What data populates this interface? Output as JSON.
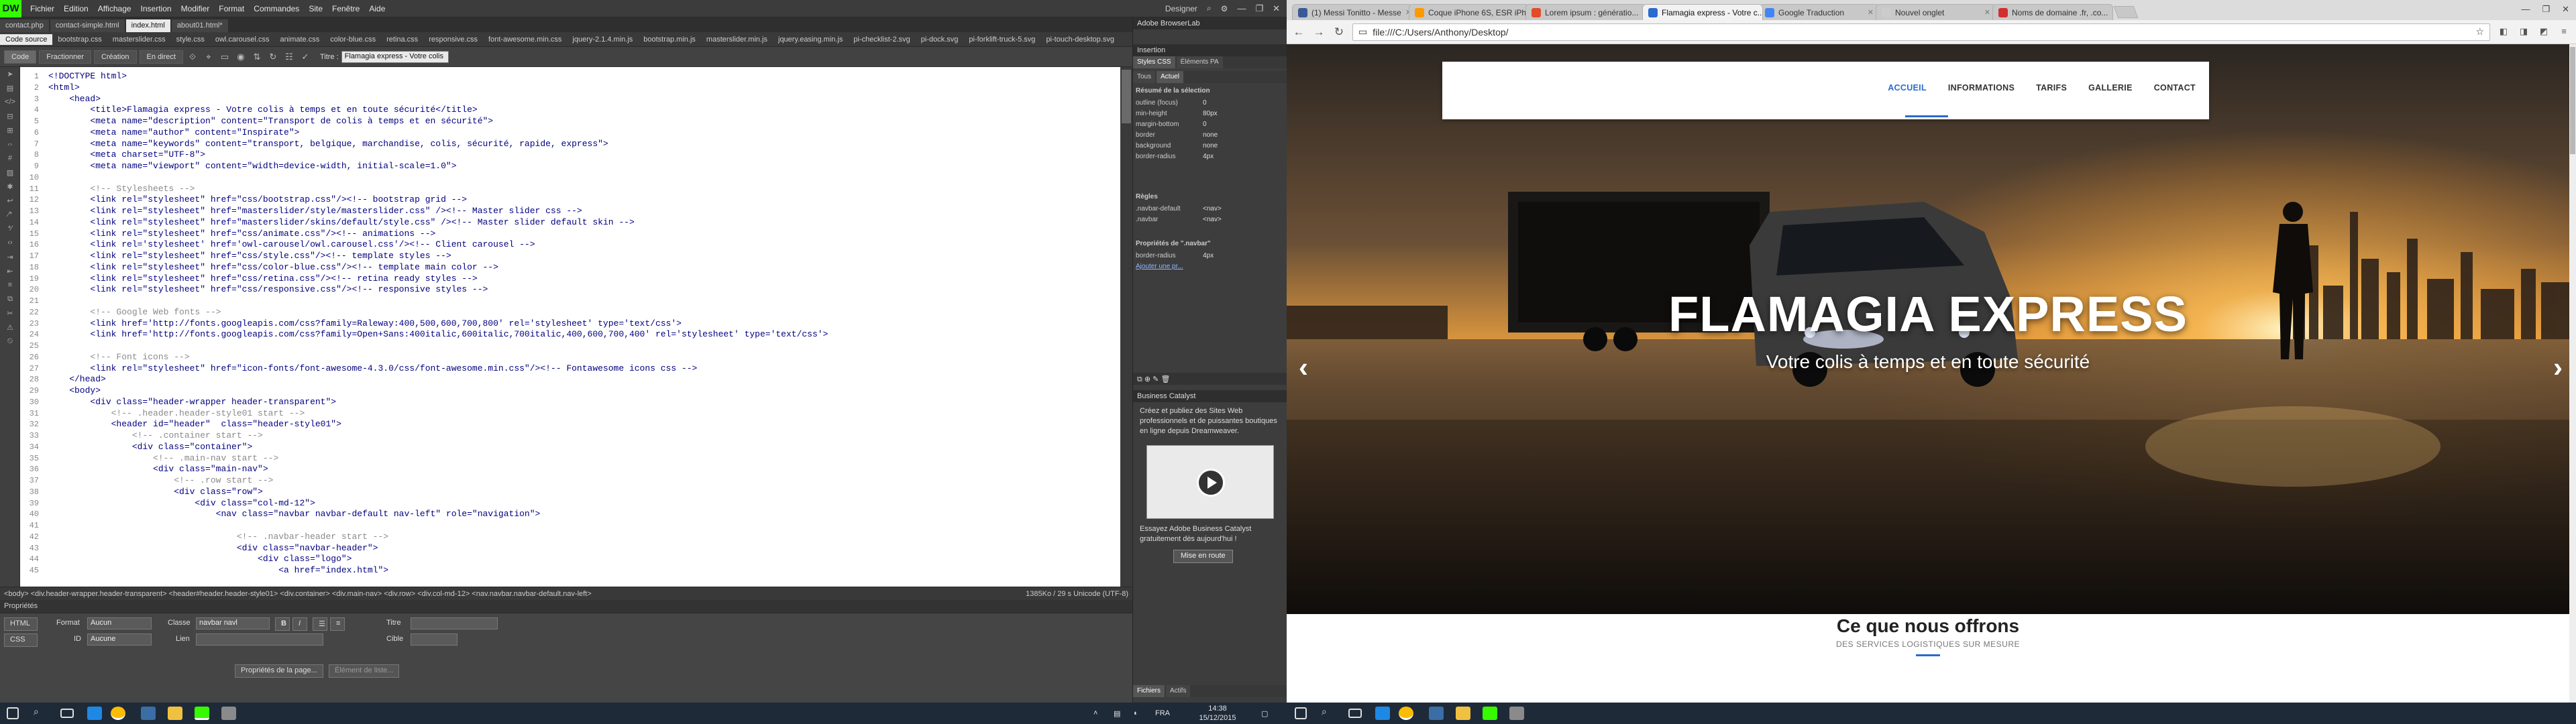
{
  "dw": {
    "logo": "DW",
    "menus": [
      "Fichier",
      "Edition",
      "Affichage",
      "Insertion",
      "Modifier",
      "Format",
      "Commandes",
      "Site",
      "Fenêtre",
      "Aide"
    ],
    "workspace": "Designer",
    "doc_tabs": [
      "contact.php",
      "contact-simple.html",
      "index.html",
      "about01.html*"
    ],
    "active_doc_tab": 2,
    "related_files": [
      "Code source",
      "bootstrap.css",
      "masterslider.css",
      "style.css",
      "owl.carousel.css",
      "animate.css",
      "color-blue.css",
      "retina.css",
      "responsive.css",
      "font-awesome.min.css",
      "jquery-2.1.4.min.js",
      "bootstrap.min.js",
      "masterslider.min.js",
      "jquery.easing.min.js",
      "pi-checklist-2.svg",
      "pi-dock.svg",
      "pi-forklift-truck-5.svg",
      "pi-touch-desktop.svg"
    ],
    "view_buttons": [
      "Code",
      "Fractionner",
      "Création",
      "En direct"
    ],
    "title_label": "Titre :",
    "title_value": "Flamagia express - Votre colis",
    "gutter_icons": [
      "pointer-icon",
      "file-icon",
      "code-icon",
      "collapse-icon",
      "expand-icon",
      "select-icon",
      "line-numbers-icon",
      "highlight-icon",
      "syntax-icon",
      "wrap-icon",
      "comment-icon",
      "uncomment-icon",
      "tag-icon",
      "indent-icon",
      "outdent-icon",
      "format-icon",
      "move-css-icon",
      "snippet-icon",
      "error-icon",
      "recent-icon"
    ],
    "code_lines": [
      {
        "t": "<!DOCTYPE html>",
        "c": false
      },
      {
        "t": "<html>",
        "c": false
      },
      {
        "t": "    <head>",
        "c": false
      },
      {
        "t": "        <title>Flamagia express - Votre colis à temps et en toute sécurité</title>",
        "c": false
      },
      {
        "t": "        <meta name=\"description\" content=\"Transport de colis à temps et en sécurité\">",
        "c": false
      },
      {
        "t": "        <meta name=\"author\" content=\"Inspirate\">",
        "c": false
      },
      {
        "t": "        <meta name=\"keywords\" content=\"transport, belgique, marchandise, colis, sécurité, rapide, express\">",
        "c": false
      },
      {
        "t": "        <meta charset=\"UTF-8\">",
        "c": false
      },
      {
        "t": "        <meta name=\"viewport\" content=\"width=device-width, initial-scale=1.0\">",
        "c": false
      },
      {
        "t": "",
        "c": false
      },
      {
        "t": "        <!-- Stylesheets -->",
        "c": true
      },
      {
        "t": "        <link rel=\"stylesheet\" href=\"css/bootstrap.css\"/><!-- bootstrap grid -->",
        "c": false
      },
      {
        "t": "        <link rel=\"stylesheet\" href=\"masterslider/style/masterslider.css\" /><!-- Master slider css -->",
        "c": false
      },
      {
        "t": "        <link rel=\"stylesheet\" href=\"masterslider/skins/default/style.css\" /><!-- Master slider default skin -->",
        "c": false
      },
      {
        "t": "        <link rel=\"stylesheet\" href=\"css/animate.css\"/><!-- animations -->",
        "c": false
      },
      {
        "t": "        <link rel='stylesheet' href='owl-carousel/owl.carousel.css'/><!-- Client carousel -->",
        "c": false
      },
      {
        "t": "        <link rel=\"stylesheet\" href=\"css/style.css\"/><!-- template styles -->",
        "c": false
      },
      {
        "t": "        <link rel=\"stylesheet\" href=\"css/color-blue.css\"/><!-- template main color -->",
        "c": false
      },
      {
        "t": "        <link rel=\"stylesheet\" href=\"css/retina.css\"/><!-- retina ready styles -->",
        "c": false
      },
      {
        "t": "        <link rel=\"stylesheet\" href=\"css/responsive.css\"/><!-- responsive styles -->",
        "c": false
      },
      {
        "t": "",
        "c": false
      },
      {
        "t": "        <!-- Google Web fonts -->",
        "c": true
      },
      {
        "t": "        <link href='http://fonts.googleapis.com/css?family=Raleway:400,500,600,700,800' rel='stylesheet' type='text/css'>",
        "c": false
      },
      {
        "t": "        <link href='http://fonts.googleapis.com/css?family=Open+Sans:400italic,600italic,700italic,400,600,700,400' rel='stylesheet' type='text/css'>",
        "c": false
      },
      {
        "t": "",
        "c": false
      },
      {
        "t": "        <!-- Font icons -->",
        "c": true
      },
      {
        "t": "        <link rel=\"stylesheet\" href=\"icon-fonts/font-awesome-4.3.0/css/font-awesome.min.css\"/><!-- Fontawesome icons css -->",
        "c": false
      },
      {
        "t": "    </head>",
        "c": false
      },
      {
        "t": "    <body>",
        "c": false
      },
      {
        "t": "        <div class=\"header-wrapper header-transparent\">",
        "c": false
      },
      {
        "t": "            <!-- .header.header-style01 start -->",
        "c": true
      },
      {
        "t": "            <header id=\"header\"  class=\"header-style01\">",
        "c": false
      },
      {
        "t": "                <!-- .container start -->",
        "c": true
      },
      {
        "t": "                <div class=\"container\">",
        "c": false
      },
      {
        "t": "                    <!-- .main-nav start -->",
        "c": true
      },
      {
        "t": "                    <div class=\"main-nav\">",
        "c": false
      },
      {
        "t": "                        <!-- .row start -->",
        "c": true
      },
      {
        "t": "                        <div class=\"row\">",
        "c": false
      },
      {
        "t": "                            <div class=\"col-md-12\">",
        "c": false
      },
      {
        "t": "                                <nav class=\"navbar navbar-default nav-left\" role=\"navigation\">",
        "c": false
      },
      {
        "t": "",
        "c": false
      },
      {
        "t": "                                    <!-- .navbar-header start -->",
        "c": true
      },
      {
        "t": "                                    <div class=\"navbar-header\">",
        "c": false
      },
      {
        "t": "                                        <div class=\"logo\">",
        "c": false
      },
      {
        "t": "                                            <a href=\"index.html\">",
        "c": false
      }
    ],
    "status_path": "<body> <div.header-wrapper.header-transparent> <header#header.header-style01> <div.container> <div.main-nav> <div.row> <div.col-md-12> <nav.navbar.navbar-default.nav-left>",
    "status_right": "1385Ko / 29 s  Unicode (UTF-8)",
    "props_title": "Propriétés",
    "props": {
      "html_label": "HTML",
      "css_label": "CSS",
      "format_label": "Format",
      "format_value": "Aucun",
      "class_label": "Classe",
      "class_value": "navbar navl",
      "id_label": "ID",
      "id_value": "Aucune",
      "link_label": "Lien",
      "title_label": "Titre",
      "target_label": "Cible",
      "page_props_btn": "Propriétés de la page...",
      "list_btn": "Élément de liste..."
    }
  },
  "panels": {
    "top_label": "Adobe BrowserLab",
    "insert_label": "Insertion",
    "css_tabs": [
      "Styles CSS",
      "Éléments PA"
    ],
    "mode_tabs": [
      "Tous",
      "Actuel"
    ],
    "summary_title": "Résumé de la sélection",
    "summary_rows": [
      {
        "k": "outline (focus)",
        "v": "0"
      },
      {
        "k": "min-height",
        "v": "80px"
      },
      {
        "k": "margin-bottom",
        "v": "0"
      },
      {
        "k": "border",
        "v": "none"
      },
      {
        "k": "background",
        "v": "none"
      },
      {
        "k": "border-radius",
        "v": "4px"
      }
    ],
    "rules_title": "Règles",
    "rules_rows": [
      {
        "k": ".navbar-default",
        "v": "<nav>"
      },
      {
        "k": ".navbar",
        "v": "<nav>"
      }
    ],
    "props_title": "Propriétés de \".navbar\"",
    "props_rows": [
      {
        "k": "border-radius",
        "v": "4px"
      }
    ],
    "add_prop": "Ajouter une pr...",
    "bc_title": "Business Catalyst",
    "bc_text": "Créez et publiez des Sites Web professionnels et de puissantes boutiques en ligne depuis Dreamweaver.",
    "bc_text2": "Essayez Adobe Business Catalyst gratuitement dès aujourd'hui !",
    "bc_button": "Mise en route",
    "bottom_tabs": [
      "Fichiers",
      "Actifs"
    ]
  },
  "chrome": {
    "tabs": [
      {
        "label": "(1) Messi Tonitto - Messe",
        "color": "#3b5998"
      },
      {
        "label": "Coque iPhone 6S, ESR iPh...",
        "color": "#ff9900"
      },
      {
        "label": "Lorem ipsum : génératio...",
        "color": "#e34c26"
      },
      {
        "label": "Flamagia express - Votre c...",
        "color": "#2a6bd0"
      },
      {
        "label": "Google Traduction",
        "color": "#4285f4"
      },
      {
        "label": "Nouvel onglet",
        "color": "#cccccc"
      },
      {
        "label": "Noms de domaine .fr, .co...",
        "color": "#d32f2f"
      }
    ],
    "active_tab": 3,
    "url": "file:///C:/Users/Anthony/Desktop/",
    "nav_items": [
      "ACCUEIL",
      "INFORMATIONS",
      "TARIFS",
      "GALLERIE",
      "CONTACT"
    ],
    "active_nav": 0,
    "hero_title": "FLAMAGIA EXPRESS",
    "hero_sub": "Votre colis à temps et en toute sécurité",
    "offer_title": "Ce que nous offrons",
    "offer_sub": "DES SERVICES LOGISTIQUES SUR MESURE"
  },
  "taskbar": {
    "lang": "FRA",
    "time": "14:38",
    "date": "15/12/2015"
  },
  "colors": {
    "accent": "#2a6bd0",
    "dw_green": "#35fa00"
  }
}
